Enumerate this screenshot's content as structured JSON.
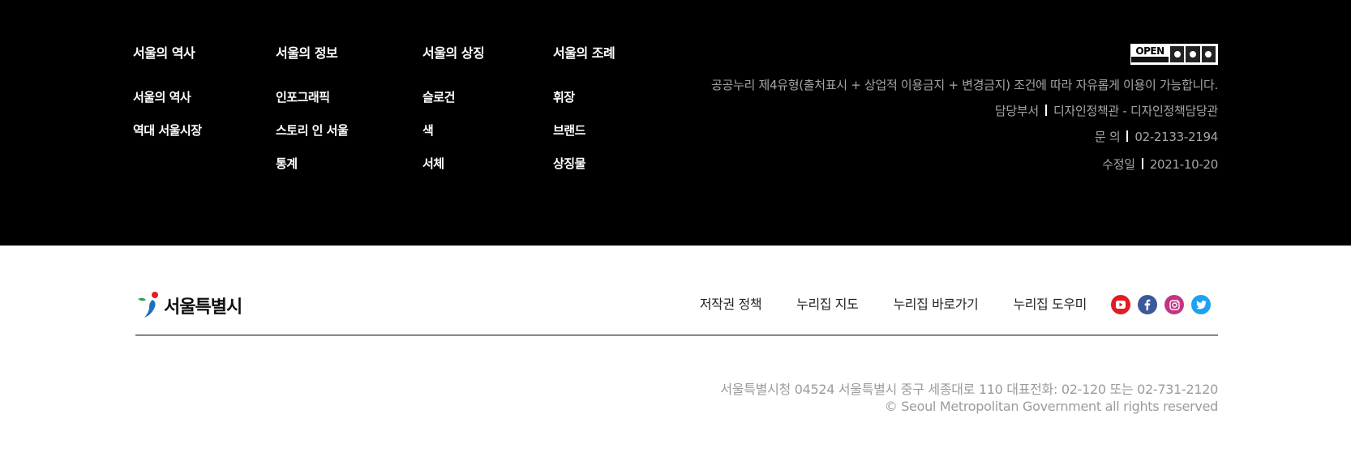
{
  "columns": [
    {
      "title": "서울의 역사",
      "links": [
        "서울의 역사",
        "역대 서울시장"
      ]
    },
    {
      "title": "서울의 정보",
      "links": [
        "인포그래픽",
        "스토리 인 서울",
        "통계"
      ]
    },
    {
      "title": "서울의 상징",
      "links": [
        "슬로건",
        "색",
        "서체"
      ]
    },
    {
      "title": "서울의 조례",
      "links": [
        "휘장",
        "브랜드",
        "상징물"
      ]
    }
  ],
  "badge": {
    "word": "OPEN"
  },
  "license_text": "공공누리 제4유형(출처표시 + 상업적 이용금지 + 변경금지) 조건에 따라 자유롭게 이용이 가능합니다.",
  "info": {
    "dept_label": "담당부서",
    "dept_value": "디자인정책관 - 디자인정책담당관",
    "contact_label": "문 의",
    "contact_value": "02-2133-2194",
    "modified_label": "수정일",
    "modified_value": "2021-10-20"
  },
  "logo": {
    "text": "서울특별시"
  },
  "footer_nav": [
    "저작권 정책",
    "누리집 지도",
    "누리집 바로가기",
    "누리집 도우미"
  ],
  "sns": [
    {
      "name": "youtube",
      "color": "#e31b23"
    },
    {
      "name": "facebook",
      "color": "#3b5998"
    },
    {
      "name": "instagram",
      "color": "#c13584"
    },
    {
      "name": "twitter",
      "color": "#1da1f2"
    }
  ],
  "address_line": "서울특별시청 04524 서울특별시 중구 세종대로 110 대표전화: 02-120 또는 02-731-2120",
  "copyright_line": "© Seoul Metropolitan Government all rights reserved"
}
